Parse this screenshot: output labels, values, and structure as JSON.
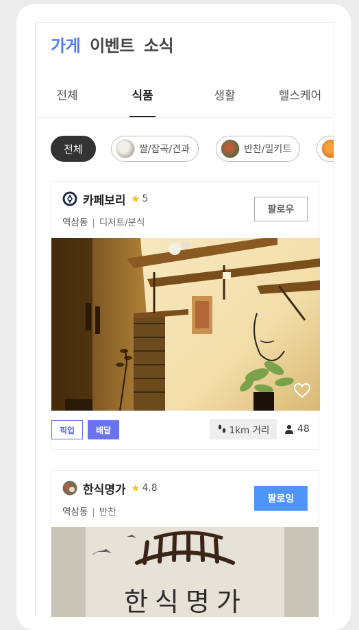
{
  "main_tabs": [
    {
      "label": "가게",
      "active": true
    },
    {
      "label": "이벤트",
      "active": false
    },
    {
      "label": "소식",
      "active": false
    }
  ],
  "sub_tabs": [
    {
      "label": "전체",
      "active": false
    },
    {
      "label": "식품",
      "active": true
    },
    {
      "label": "생활",
      "active": false
    },
    {
      "label": "헬스케어",
      "active": false
    }
  ],
  "chips": [
    {
      "label": "전체",
      "active": true
    },
    {
      "label": "쌀/잡곡/견과",
      "icon": "grain-thumbnail"
    },
    {
      "label": "반찬/밀키트",
      "icon": "side-dish-thumbnail"
    },
    {
      "label": "",
      "icon": "fruit-thumbnail"
    }
  ],
  "stores": [
    {
      "name": "카페보리",
      "rating": "5",
      "location": "역삼동",
      "category": "디저트/분식",
      "follow_label": "팔로우",
      "following": false,
      "tags": [
        "픽업",
        "배달"
      ],
      "distance": "1km 거리",
      "followers": "48",
      "photo": "cafe-interior-photo"
    },
    {
      "name": "한식명가",
      "rating": "4.8",
      "location": "역삼동",
      "category": "반찬",
      "follow_label": "팔로잉",
      "following": true,
      "photo_text": "한식명가",
      "photo": "hansik-sign-photo"
    }
  ],
  "colors": {
    "accent": "#4e7bf0",
    "following_button": "#4d96f7",
    "delivery_tag": "#6a72f2",
    "star": "#f4c21a"
  }
}
